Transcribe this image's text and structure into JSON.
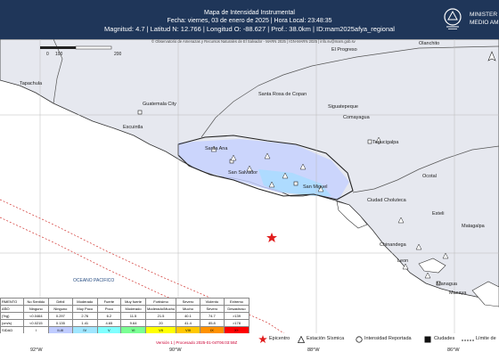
{
  "header": {
    "title": "Mapa de Intensidad Instrumental",
    "date_line": "Fecha: viernes, 03 de enero de 2025 | Hora Local: 23:48:35",
    "params_line": "Magnitud: 4.7 | Latitud N: 12.766 | Longitud O: -88.627 | Prof.: 38.0km | ID:mam2025afya_regional",
    "ministry_lines": [
      "MINISTER",
      "MEDIO AM"
    ],
    "colors": {
      "header_bg": "#1f3659",
      "epicenter": "#e11d1d",
      "water": "#ffffff"
    }
  },
  "map": {
    "credit": "© Observatorio de Amenazas y Recursos Naturales de El Salvador - MARN 2025 | IGN-MARN 2025 | info.sv@marn.gob.sv",
    "scale": {
      "labels": [
        "0",
        "100",
        "200"
      ],
      "unit": "km"
    },
    "places": [
      {
        "name": "Olanchito",
        "kind": "city"
      },
      {
        "name": "El Progreso",
        "kind": "city"
      },
      {
        "name": "Tapachula",
        "kind": "city"
      },
      {
        "name": "Santa Rosa de Copan",
        "kind": "city"
      },
      {
        "name": "Siguatepeque",
        "kind": "city"
      },
      {
        "name": "Comayagua",
        "kind": "city"
      },
      {
        "name": "Tegucigalpa",
        "kind": "city"
      },
      {
        "name": "Guatemala City",
        "kind": "city"
      },
      {
        "name": "Escuintla",
        "kind": "city"
      },
      {
        "name": "Santa Ana",
        "kind": "city"
      },
      {
        "name": "San Salvador",
        "kind": "city"
      },
      {
        "name": "San Miguel",
        "kind": "city"
      },
      {
        "name": "Choluteca",
        "kind": "city"
      },
      {
        "name": "Ciudad Choluteca",
        "kind": "city"
      },
      {
        "name": "Ocotal",
        "kind": "city"
      },
      {
        "name": "Esteli",
        "kind": "city"
      },
      {
        "name": "Matagalpa",
        "kind": "city"
      },
      {
        "name": "Chinandega",
        "kind": "city"
      },
      {
        "name": "Leon",
        "kind": "city"
      },
      {
        "name": "Managua",
        "kind": "city"
      },
      {
        "name": "Masaya",
        "kind": "city"
      },
      {
        "name": "OCEANO PACIFICO",
        "kind": "ocean"
      }
    ]
  },
  "legend": {
    "rows": [
      {
        "label": "RMENTO",
        "values": [
          "No Sentido",
          "Débil",
          "Moderado",
          "Fuerte",
          "Muy fuerte",
          "Fortísimo",
          "Severo",
          "Violento",
          "Extremo"
        ]
      },
      {
        "label": "AÑO",
        "values": [
          "Ninguno",
          "Ninguno",
          "Muy Poco",
          "Poco",
          "Moderado",
          "Moderado/Mucho",
          "Mucho",
          "Severo",
          "Desastroso"
        ]
      },
      {
        "label": "(%g)",
        "values": [
          "<0.0464",
          "0.297",
          "2.76",
          "6.2",
          "11.5",
          "21.5",
          "40.1",
          "74.7",
          ">139"
        ]
      },
      {
        "label": "(cm/s)",
        "values": [
          "<0.0215",
          "0.135",
          "1.41",
          "4.65",
          "9.64",
          "20",
          "41.4",
          "85.8",
          ">178"
        ]
      },
      {
        "label": "SIDAD",
        "values": [
          "I",
          "II-III",
          "IV",
          "V",
          "VI",
          "VII",
          "VIII",
          "IX",
          "X+"
        ]
      }
    ],
    "row_colors": [
      "#ffffff",
      "#bfccff",
      "#a0e6ff",
      "#80ffff",
      "#7aff93",
      "#ffff00",
      "#ffc800",
      "#ff9100",
      "#ff0000"
    ],
    "caption": "por Worden et al. (2012)"
  },
  "footer": {
    "version": "Versión 1 | Procesado 2025-01-04T06:03:59Z",
    "epicentro": "Epicentro",
    "estacion": "Estación Sísmica",
    "intensidad": "Intensidad Reportada",
    "ciudades": "Ciudades",
    "limite": "Límite de"
  },
  "axes": {
    "lon_labels": [
      "92°W",
      "90°W",
      "88°W",
      "86°W"
    ]
  }
}
